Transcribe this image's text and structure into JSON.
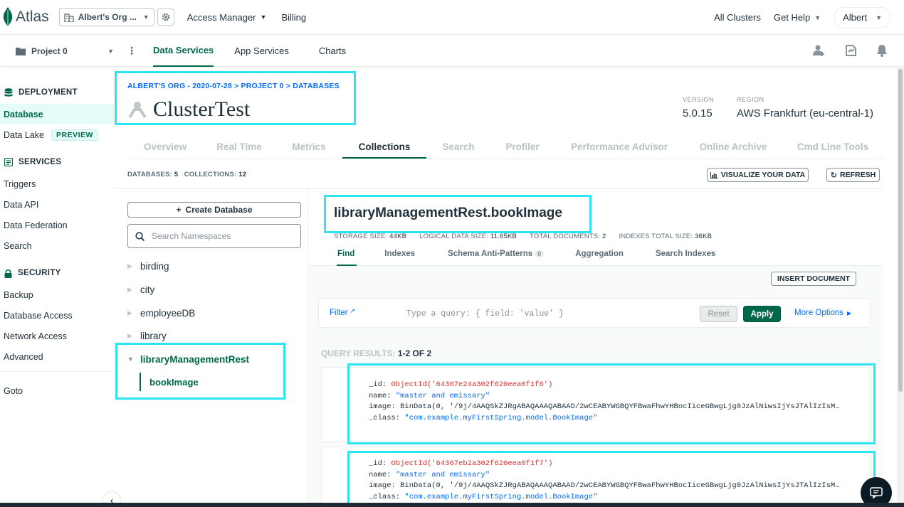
{
  "topbar": {
    "logo_text": "Atlas",
    "org_name": "Albert's Org ...",
    "access_manager": "Access Manager",
    "billing": "Billing",
    "all_clusters": "All Clusters",
    "get_help": "Get Help",
    "user": "Albert"
  },
  "projbar": {
    "project": "Project 0",
    "tabs": [
      "Data Services",
      "App Services",
      "Charts"
    ]
  },
  "sidebar": {
    "deployment": "DEPLOYMENT",
    "database": "Database",
    "data_lake": "Data Lake",
    "preview": "PREVIEW",
    "services": "SERVICES",
    "triggers": "Triggers",
    "data_api": "Data API",
    "data_federation": "Data Federation",
    "search": "Search",
    "security": "SECURITY",
    "backup": "Backup",
    "database_access": "Database Access",
    "network_access": "Network Access",
    "advanced": "Advanced",
    "goto": "Goto"
  },
  "main": {
    "breadcrumb": "ALBERT'S ORG - 2020-07-28 > PROJECT 0 > DATABASES",
    "cluster_name": "ClusterTest",
    "version_label": "VERSION",
    "version": "5.0.15",
    "region_label": "REGION",
    "region": "AWS Frankfurt (eu-central-1)",
    "tabs": [
      "Overview",
      "Real Time",
      "Metrics",
      "Collections",
      "Search",
      "Profiler",
      "Performance Advisor",
      "Online Archive",
      "Cmd Line Tools"
    ],
    "databases_label": "DATABASES:",
    "databases_count": "5",
    "collections_label": "COLLECTIONS:",
    "collections_count": "12",
    "visualize": "VISUALIZE YOUR DATA",
    "refresh": "REFRESH"
  },
  "namespaces": {
    "create_database": "Create Database",
    "search_placeholder": "Search Namespaces",
    "databases": [
      "birding",
      "city",
      "employeeDB",
      "library",
      "libraryManagementRest"
    ],
    "open_collection": "bookImage"
  },
  "collection": {
    "name": "libraryManagementRest.bookImage",
    "storage_size_label": "STORAGE SIZE:",
    "storage_size": "44KB",
    "logical_size_label": "LOGICAL DATA SIZE:",
    "logical_size": "11.65KB",
    "total_docs_label": "TOTAL DOCUMENTS:",
    "total_docs": "2",
    "indexes_size_label": "INDEXES TOTAL SIZE:",
    "indexes_size": "36KB",
    "tabs": [
      "Find",
      "Indexes",
      "Schema Anti-Patterns",
      "Aggregation",
      "Search Indexes"
    ],
    "anti_patterns_count": "0",
    "insert_document": "INSERT DOCUMENT",
    "filter_label": "Filter",
    "filter_placeholder": "Type a query: { field: 'value' }",
    "reset": "Reset",
    "apply": "Apply",
    "more_options": "More Options",
    "query_results_label": "QUERY RESULTS:",
    "query_results_range": "1-2 OF 2",
    "documents": [
      {
        "id_key": "_id:",
        "id_value": "ObjectId('64367e24a302f620eea0f1f6')",
        "name_key": "name:",
        "name_value": "\"master and emissary\"",
        "image_key": "image:",
        "image_value": "BinData(0, '/9j/4AAQSkZJRgABAQAAAQABAAD/2wCEABYWGBQYFBwaFhwYHBocIiceGBwgLjg0JzAlNiwsIjYsJTAlIzIsM…",
        "class_key": "_class:",
        "class_value": "\"com.example.myFirstSpring.model.BookImage\""
      },
      {
        "id_key": "_id:",
        "id_value": "ObjectId('64367eb2a302f620eea0f1f7')",
        "name_key": "name:",
        "name_value": "\"master and emissary\"",
        "image_key": "image:",
        "image_value": "BinData(0, '/9j/4AAQSkZJRgABAQAAAQABAAD/2wCEABYWGBQYFBwaFhwYHBocIiceGBwgLjg0JzAlNiwsIjYsJTAlIzIsM…",
        "class_key": "_class:",
        "class_value": "\"com.example.myFirstSpring.model.BookImage\""
      }
    ]
  },
  "colors": {
    "brand_green": "#00684a",
    "link_blue": "#016bf8",
    "highlight": "#2ce4f2"
  }
}
